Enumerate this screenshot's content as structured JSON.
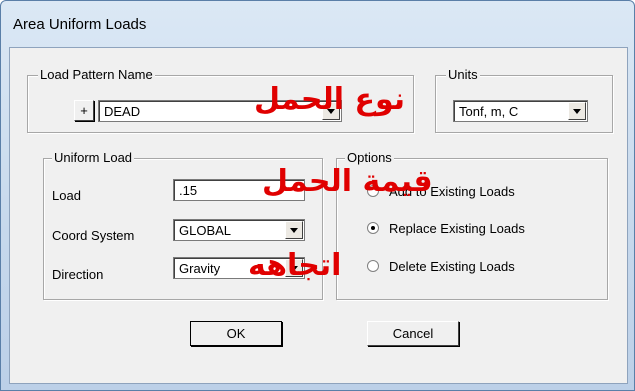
{
  "window": {
    "title": "Area Uniform Loads"
  },
  "load_pattern": {
    "legend": "Load Pattern Name",
    "plus_label": "+",
    "selected": "DEAD"
  },
  "units": {
    "legend": "Units",
    "selected": "Tonf, m, C"
  },
  "uniform_load": {
    "legend": "Uniform Load",
    "load_label": "Load",
    "load_value": ".15",
    "coord_label": "Coord System",
    "coord_value": "GLOBAL",
    "direction_label": "Direction",
    "direction_value": "Gravity"
  },
  "options": {
    "legend": "Options",
    "items": [
      {
        "label": "Add to Existing Loads",
        "selected": false
      },
      {
        "label": "Replace Existing Loads",
        "selected": true
      },
      {
        "label": "Delete Existing Loads",
        "selected": false
      }
    ]
  },
  "buttons": {
    "ok": "OK",
    "cancel": "Cancel"
  },
  "annotations": {
    "load_type": "نوع الحمل",
    "load_value": "قيمة الحمل",
    "direction": "اتجاهه"
  },
  "colors": {
    "annotation": "#e00000"
  }
}
